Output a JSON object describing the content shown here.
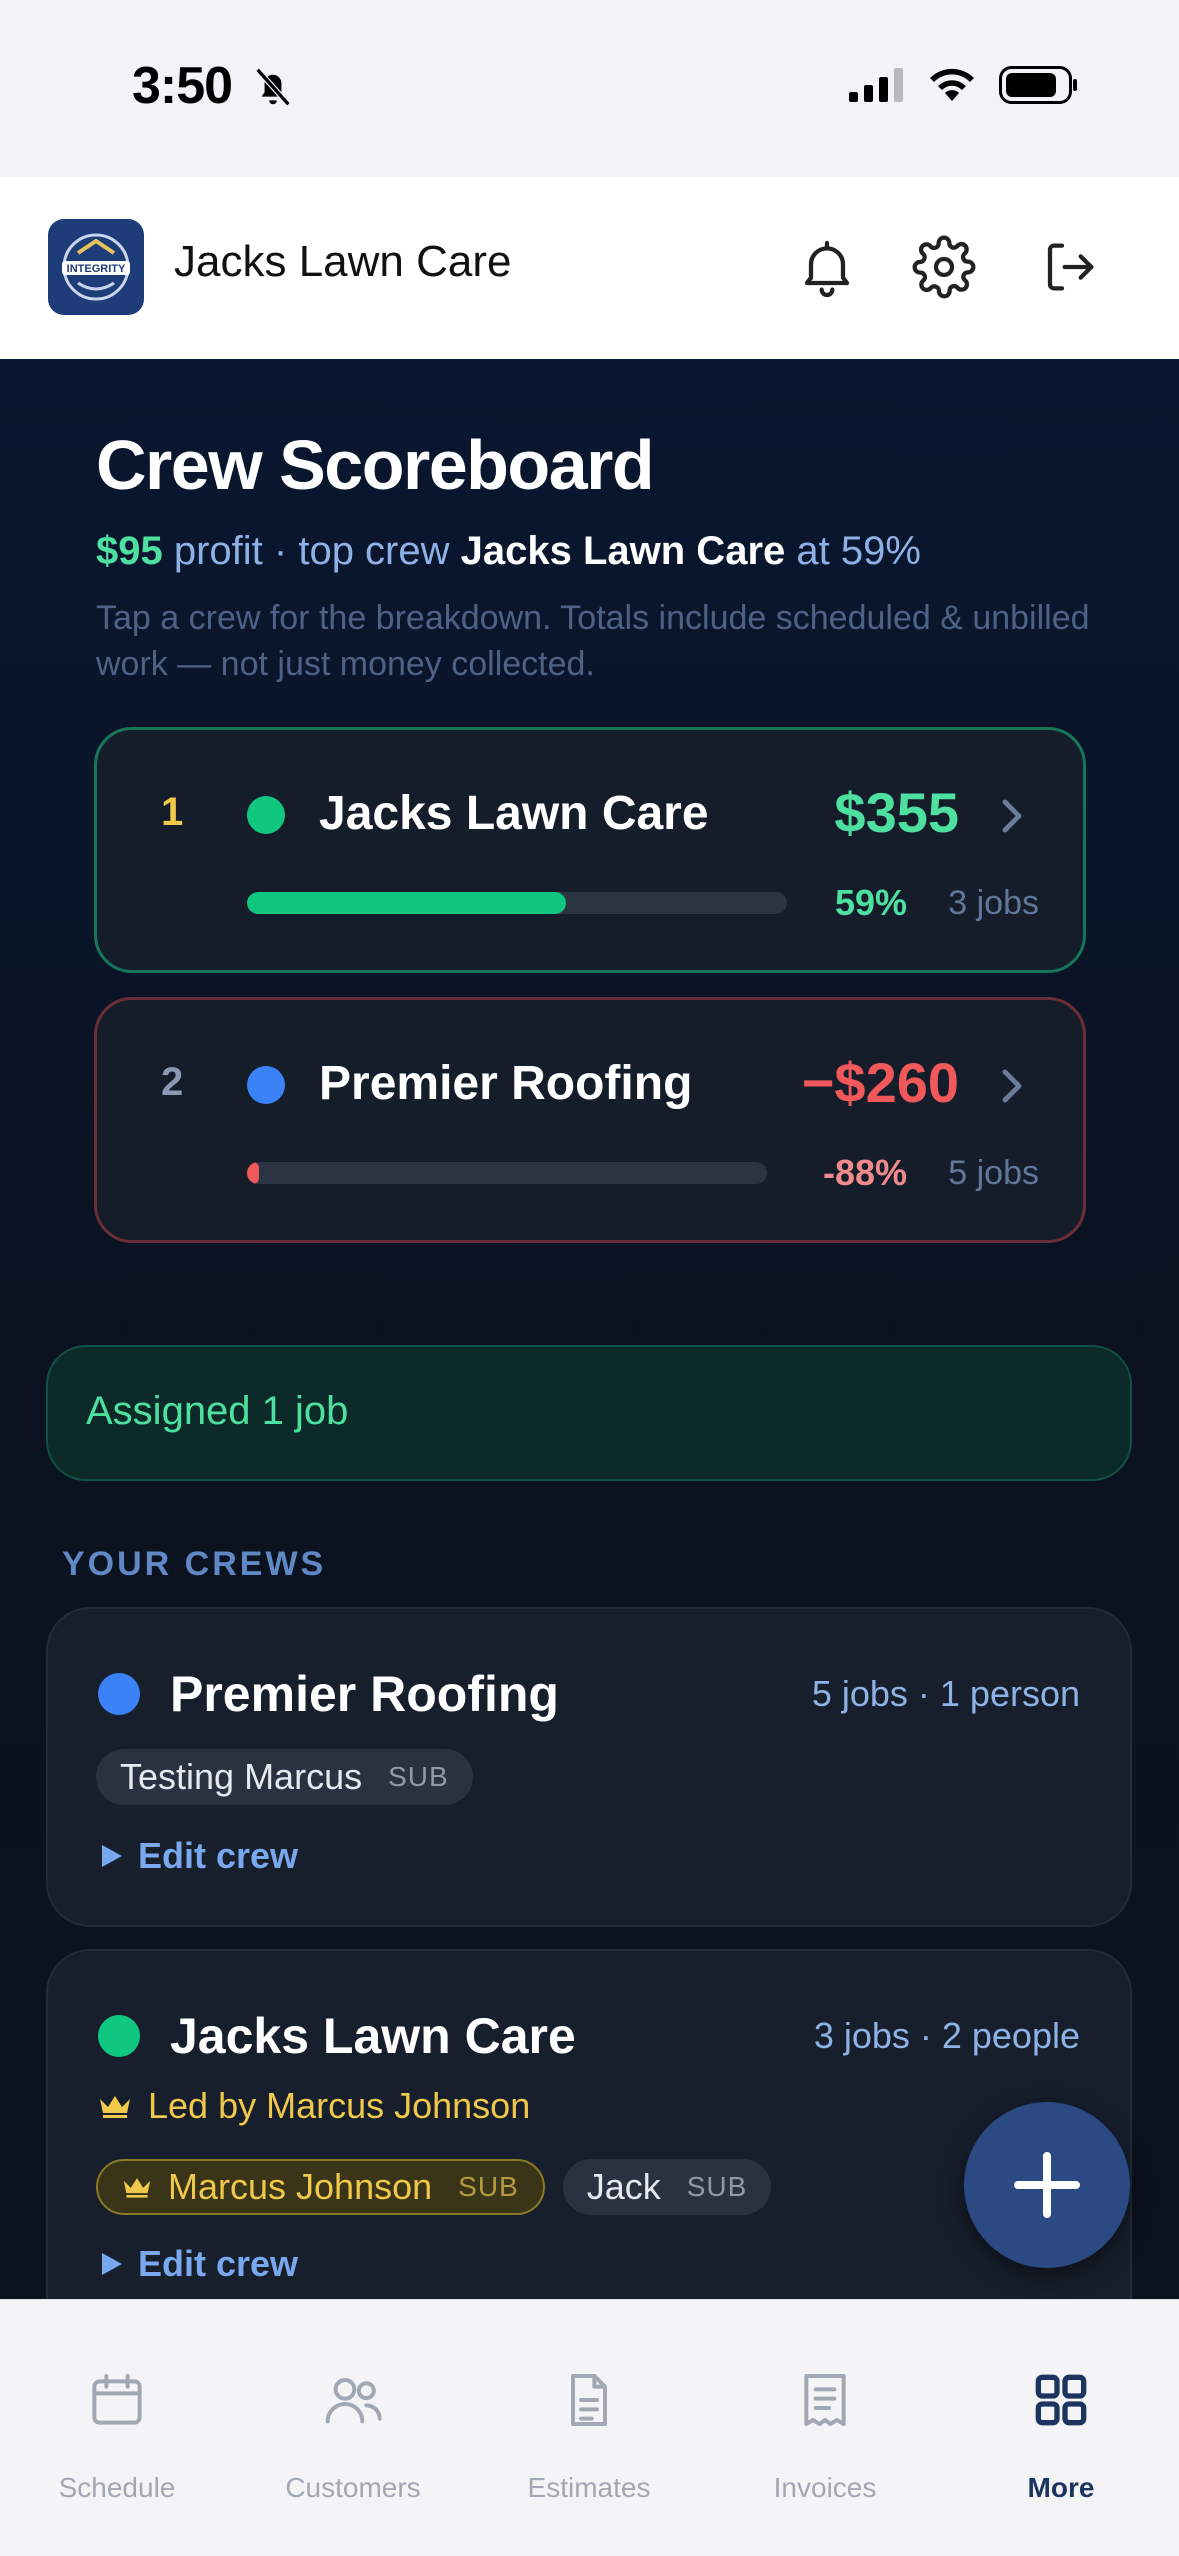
{
  "status_bar": {
    "time": "3:50"
  },
  "header": {
    "app_name": "Jacks Lawn Care",
    "logo_text": "INTEGRITY"
  },
  "scoreboard": {
    "title": "Crew Scoreboard",
    "summary": {
      "profit": "$95",
      "profit_suffix": " profit · top crew ",
      "top_crew": "Jacks Lawn Care",
      "pct_text": " at 59%"
    },
    "hint": "Tap a crew for the breakdown. Totals include scheduled & unbilled work — not just money collected.",
    "ranks": [
      {
        "rank": "1",
        "name": "Jacks Lawn Care",
        "amount": "$355",
        "percent_label": "59%",
        "percent": 59,
        "jobs": "3 jobs",
        "dot_color": "#10c77f",
        "status": "positive"
      },
      {
        "rank": "2",
        "name": "Premier Roofing",
        "amount": "−$260",
        "percent_label": "-88%",
        "percent": -88,
        "jobs": "5 jobs",
        "dot_color": "#3b82f6",
        "status": "negative"
      }
    ]
  },
  "banner": {
    "text": "Assigned 1 job"
  },
  "crews_section": {
    "label": "YOUR CREWS",
    "crews": [
      {
        "name": "Premier Roofing",
        "meta": "5 jobs · 1 person",
        "dot_color": "#3b82f6",
        "members": [
          {
            "name": "Testing Marcus",
            "tag": "SUB"
          }
        ],
        "edit_label": "Edit crew"
      },
      {
        "name": "Jacks Lawn Care",
        "meta": "3 jobs · 2 people",
        "dot_color": "#10c77f",
        "led_by": "Led by Marcus Johnson",
        "members": [
          {
            "name": "Marcus Johnson",
            "tag": "SUB",
            "lead": true
          },
          {
            "name": "Jack",
            "tag": "SUB"
          }
        ],
        "edit_label": "Edit crew"
      }
    ]
  },
  "tabs": [
    {
      "label": "Schedule",
      "icon": "calendar-icon"
    },
    {
      "label": "Customers",
      "icon": "users-icon"
    },
    {
      "label": "Estimates",
      "icon": "document-icon"
    },
    {
      "label": "Invoices",
      "icon": "receipt-icon"
    },
    {
      "label": "More",
      "icon": "grid-icon",
      "active": true
    }
  ],
  "colors": {
    "positive": "#4ee0a0",
    "negative": "#f0585a",
    "accent": "#2b4a83"
  }
}
